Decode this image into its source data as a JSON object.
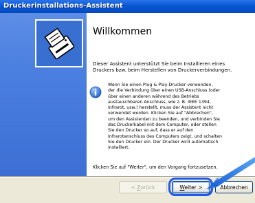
{
  "window": {
    "title": "Druckerinstallations-Assistent"
  },
  "welcome": {
    "heading": "Willkommen",
    "intro": "Dieser Assistent unterstützt Sie beim Installieren eines Druckers bzw. beim Herstellen von Druckerverbindungen.",
    "info_lines": [
      "Wenn Sie einen Plug & Play-Drucker verwenden,",
      "der die Verbindung über einen USB-Anschluss (oder",
      "über einen anderen während des Betriebs",
      "austauschbaren Anschluss, wie z. B. IEEE 1394,",
      "Infrarot, usw.) herstellt, muss der Assistent nicht",
      "verwendet werden. Klicken Sie auf \"Abbrechen\",",
      "um den Assistenten zu beenden, und verbinden Sie",
      "das Druckerkabel mit dem Computer, oder stellen",
      "Sie den Drucker so auf, dass er auf den",
      "Infrarotanschluss des Computers zeigt, und schalten",
      "Sie den Drucker ein. Der Drucker wird automatisch",
      "installiert."
    ],
    "continue": "Klicken Sie auf \"Weiter\", um den Vorgang fortzusetzen."
  },
  "buttons": {
    "back": {
      "prefix": "< ",
      "mnemonic": "Z",
      "rest": "urück"
    },
    "next": {
      "mnemonic": "W",
      "rest": "eiter",
      "suffix": " >"
    },
    "cancel": "Abbrechen"
  },
  "icons": {
    "wizard": "printer-wizard-icon",
    "info": "info-icon",
    "arrow": "pointer-arrow-icon"
  },
  "colors": {
    "titlebar": "#0856d3",
    "leftpanel": "#4b7fe0",
    "highlight": "#1f5be8",
    "arrow": "#2d7ee0"
  }
}
